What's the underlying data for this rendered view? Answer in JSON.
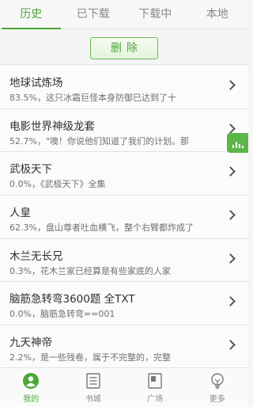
{
  "tabs": [
    {
      "label": "历史",
      "active": true
    },
    {
      "label": "已下载",
      "active": false
    },
    {
      "label": "下载中",
      "active": false
    },
    {
      "label": "本地",
      "active": false
    }
  ],
  "actions": {
    "delete_label": "删除"
  },
  "list": [
    {
      "title": "地球试炼场",
      "subtitle": "83.5%，这只冰霜巨怪本身防御已达到了十"
    },
    {
      "title": "电影世界神级龙套",
      "subtitle": "52.7%，\"噢！你说他们知道了我们的计划。那"
    },
    {
      "title": "武极天下",
      "subtitle": "0.0%，《武极天下》全集"
    },
    {
      "title": "人皇",
      "subtitle": "62.3%，盘山尊者吐血横飞，整个右臂都炸成了"
    },
    {
      "title": "木兰无长兄",
      "subtitle": "0.3%，花木兰家已经算是有些家底的人家"
    },
    {
      "title": "脑筋急转弯3600题 全TXT",
      "subtitle": "0.0%，脑筋急转弯==001"
    },
    {
      "title": "九天神帝",
      "subtitle": "2.2%，是一些残卷，属于不完整的，完整"
    }
  ],
  "bottom_nav": [
    {
      "label": "我的",
      "icon": "user-icon",
      "active": true
    },
    {
      "label": "书城",
      "icon": "book-icon",
      "active": false
    },
    {
      "label": "广场",
      "icon": "square-icon",
      "active": false
    },
    {
      "label": "更多",
      "icon": "bulb-icon",
      "active": false
    }
  ],
  "colors": {
    "accent": "#4aa836",
    "floating_tab": "#5cb547"
  }
}
